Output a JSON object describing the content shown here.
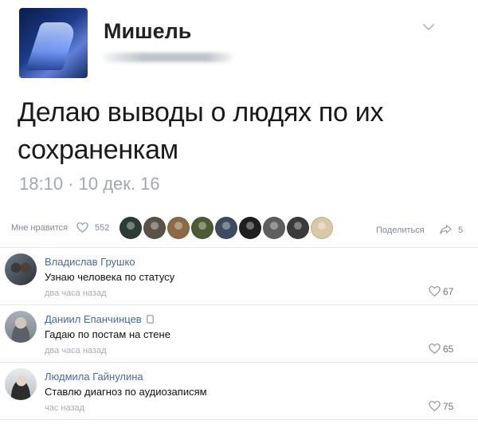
{
  "post": {
    "author": "Мишель",
    "text_line1": "Делаю выводы о людях по их",
    "text_line2": "сохраненкам",
    "meta": "18:10 · 10 дек. 16"
  },
  "reactions": {
    "likes_label": "Мне нравится",
    "likes_count": "552",
    "share_label": "Поделиться",
    "share_count": "5",
    "face_colors": [
      "#2c3b34",
      "#5a5148",
      "#8b6a45",
      "#4e5a33",
      "#3d4a62",
      "#1f1f1f",
      "#5e5e5e",
      "#3a3a3a",
      "#d9c8a6"
    ]
  },
  "comments": [
    {
      "author": "Владислав Грушко",
      "text": "Узнаю человека по статусу",
      "time": "два часа назад",
      "likes": "67"
    },
    {
      "author": "Даниил Епанчинцев",
      "text": "Гадаю по постам на стене",
      "time": "два часа назад",
      "likes": "65"
    },
    {
      "author": "Людмила Гайнулина",
      "text": "Ставлю диагноз по аудиозаписям",
      "time": "час назад",
      "likes": "75"
    }
  ]
}
